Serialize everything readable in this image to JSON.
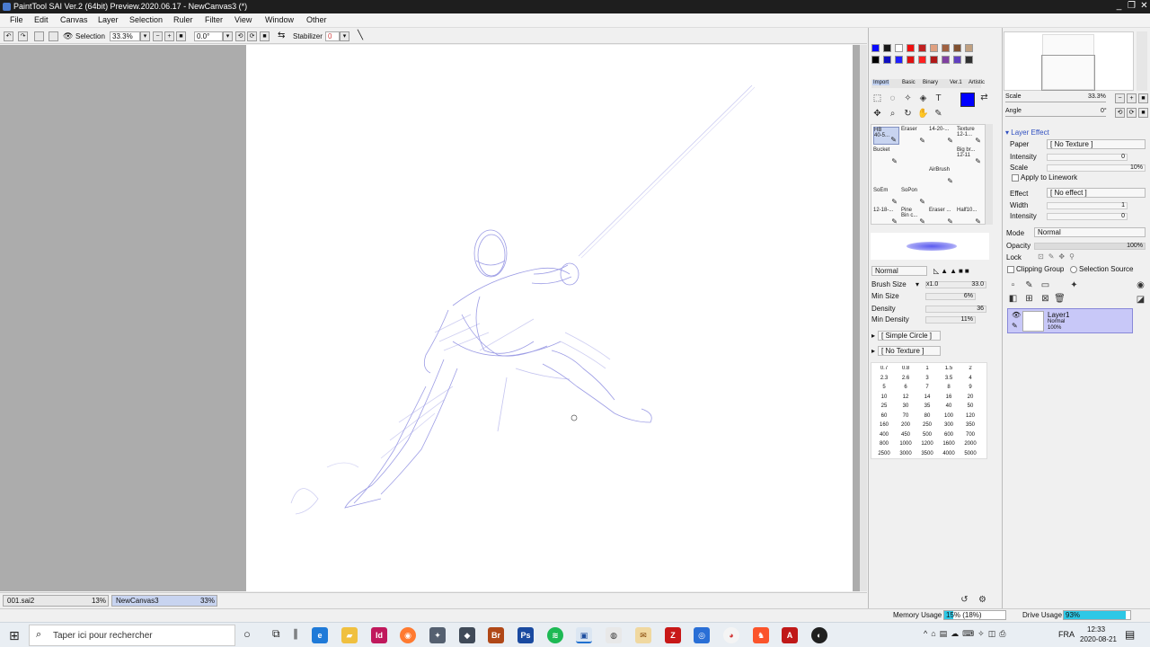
{
  "window": {
    "title": "PaintTool SAI Ver.2 (64bit) Preview.2020.06.17 - NewCanvas3 (*)",
    "controls": [
      "_",
      "❐",
      "✕"
    ]
  },
  "menu": [
    "File",
    "Edit",
    "Canvas",
    "Layer",
    "Selection",
    "Ruler",
    "Filter",
    "View",
    "Window",
    "Other"
  ],
  "toolbar": {
    "selection_label": "Selection",
    "zoom": "33.3%",
    "rotation": "0.0°",
    "stabilizer_label": "Stabilizer",
    "stabilizer_value": "0"
  },
  "colors": {
    "swatches_row1": [
      "#0a0aff",
      "#1a1a1a",
      "#ffffff",
      "#f01010",
      "#c02020",
      "#e0a080",
      "#a06040",
      "#805030",
      "#c0a080"
    ],
    "swatches_row2": [
      "#000000",
      "#1010c0",
      "#2020ff",
      "#e01010",
      "#ff2020",
      "#b01818",
      "#8040a0",
      "#6040c0",
      "#303030"
    ],
    "current": "#0000ff",
    "sketch_stroke": "#7b7bdc"
  },
  "tool_tabs": [
    "Import",
    "Basic",
    "Binary",
    "Ver.1",
    "Artistic"
  ],
  "brushes": [
    {
      "name": "HB",
      "sub": "40-5...",
      "row": 0,
      "col": 0
    },
    {
      "name": "Eraser",
      "sub": "",
      "row": 0,
      "col": 1
    },
    {
      "name": "14-20-...",
      "sub": "",
      "row": 0,
      "col": 2
    },
    {
      "name": "Texture",
      "sub": "12-1...",
      "row": 0,
      "col": 3
    },
    {
      "name": "Bucket",
      "sub": "",
      "row": 1,
      "col": 0
    },
    {
      "name": "Big br...",
      "sub": "12-11",
      "row": 1,
      "col": 3
    },
    {
      "name": "AirBrush",
      "sub": "",
      "row": 2,
      "col": 2
    },
    {
      "name": "SoEm",
      "sub": "",
      "row": 3,
      "col": 0
    },
    {
      "name": "SoPon",
      "sub": "",
      "row": 3,
      "col": 1
    },
    {
      "name": "12-18-...",
      "sub": "",
      "row": 4,
      "col": 0
    },
    {
      "name": "Pine",
      "sub": "Bin c...",
      "row": 4,
      "col": 1
    },
    {
      "name": "Eraser ...",
      "sub": "",
      "row": 4,
      "col": 2
    },
    {
      "name": "Half10...",
      "sub": "",
      "row": 4,
      "col": 3
    }
  ],
  "brush_props": {
    "blend_mode": "Normal",
    "brush_size_label": "Brush Size",
    "brush_size_mult": "x1.0",
    "brush_size": "33.0",
    "min_size_label": "Min Size",
    "min_size": "6%",
    "density_label": "Density",
    "density": "36",
    "min_density_label": "Min Density",
    "min_density": "11%",
    "shape": "[ Simple Circle ]",
    "texture": "[ No Texture ]"
  },
  "size_presets": [
    [
      "0.7",
      "0.8",
      "1",
      "1.5",
      "2"
    ],
    [
      "2.3",
      "2.6",
      "3",
      "3.5",
      "4"
    ],
    [
      "5",
      "6",
      "7",
      "8",
      "9"
    ],
    [
      "10",
      "12",
      "14",
      "16",
      "20"
    ],
    [
      "25",
      "30",
      "35",
      "40",
      "50"
    ],
    [
      "60",
      "70",
      "80",
      "100",
      "120"
    ],
    [
      "160",
      "200",
      "250",
      "300",
      "350"
    ],
    [
      "400",
      "450",
      "500",
      "600",
      "700"
    ],
    [
      "800",
      "1000",
      "1200",
      "1600",
      "2000"
    ],
    [
      "2500",
      "3000",
      "3500",
      "4000",
      "5000"
    ]
  ],
  "navigator": {
    "scale_label": "Scale",
    "scale": "33.3%",
    "angle_label": "Angle",
    "angle": "0°"
  },
  "layer_effect": {
    "header": "Layer Effect",
    "paper_label": "Paper",
    "paper": "[ No Texture ]",
    "intensity_label": "Intensity",
    "intensity": "0",
    "scale_label": "Scale",
    "scale": "10%",
    "apply_linework": "Apply to Linework",
    "effect_label": "Effect",
    "effect": "[ No effect ]",
    "width_label": "Width",
    "width": "1",
    "intensity2_label": "Intensity",
    "intensity2": "0"
  },
  "layer_props": {
    "mode_label": "Mode",
    "mode": "Normal",
    "opacity_label": "Opacity",
    "opacity": "100%",
    "lock_label": "Lock",
    "clipping_group": "Clipping Group",
    "selection_source": "Selection Source"
  },
  "layers": [
    {
      "name": "Layer1",
      "mode": "Normal",
      "opacity": "100%"
    }
  ],
  "documents": [
    {
      "name": "001.sai2",
      "zoom": "13%"
    },
    {
      "name": "NewCanvas3",
      "zoom": "33%"
    }
  ],
  "status": {
    "memory_label": "Memory Usage",
    "memory": "15% (18%)",
    "memory_fraction": 0.15,
    "drive_label": "Drive Usage",
    "drive": "93%",
    "drive_fraction": 0.93
  },
  "taskbar": {
    "search_placeholder": "Taper ici pour rechercher",
    "lang": "FRA",
    "time": "12:33",
    "date": "2020-08-21"
  }
}
